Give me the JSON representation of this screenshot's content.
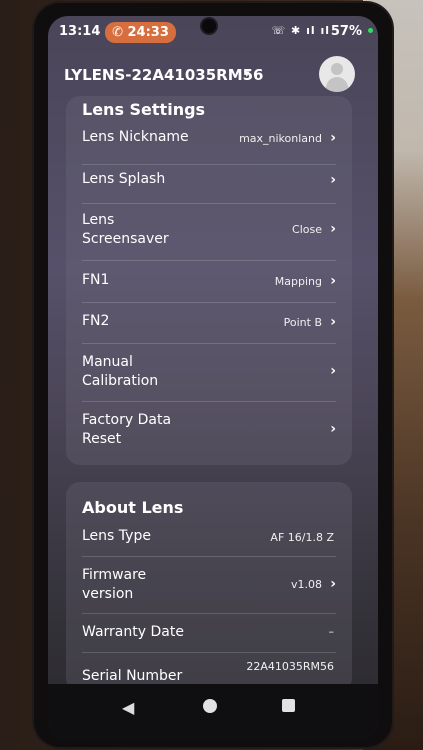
{
  "status_bar": {
    "time": "13:14",
    "call_timer": "24:33",
    "icons": "☏ ✱ ıl ıl",
    "battery": "57%"
  },
  "header": {
    "device_name": "LYLENS-22A41035RM56",
    "caret": "▾"
  },
  "lens_settings": {
    "title": "Lens Settings",
    "items": [
      {
        "label": "Lens Nickname",
        "value": "max_nikonland"
      },
      {
        "label": "Lens Splash",
        "value": ""
      },
      {
        "label": "Lens\nScreensaver",
        "value": "Close"
      },
      {
        "label": "FN1",
        "value": "Mapping"
      },
      {
        "label": "FN2",
        "value": "Point B"
      },
      {
        "label": "Manual\nCalibration",
        "value": ""
      },
      {
        "label": "Factory Data\nReset",
        "value": ""
      }
    ]
  },
  "about_lens": {
    "title": "About Lens",
    "items": [
      {
        "label": "Lens Type",
        "value": "AF 16/1.8 Z"
      },
      {
        "label": "Firmware\nversion",
        "value": "v1.08"
      },
      {
        "label": "Warranty Date",
        "value": "–"
      },
      {
        "label": "Serial Number",
        "value": "22A41035RM56"
      }
    ]
  },
  "icons": {
    "chevron": "chevron-right-icon",
    "call": "phone-icon",
    "avatar": "user-avatar-icon",
    "back": "back-icon",
    "home": "home-icon",
    "recents": "recents-icon"
  },
  "colors": {
    "call_pill": "#d66e3e",
    "card_bg": "rgba(120,116,130,0.25)"
  }
}
